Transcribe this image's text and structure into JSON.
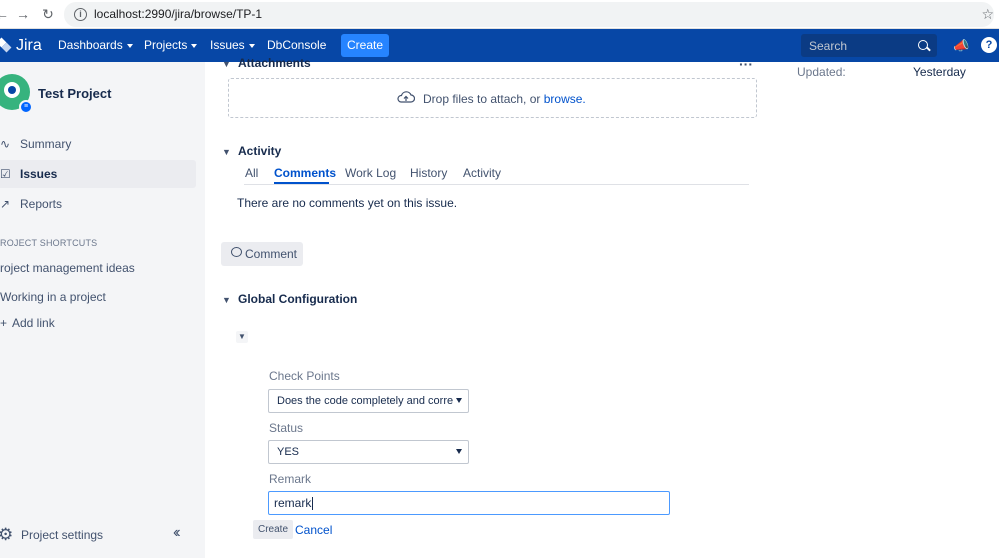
{
  "browser": {
    "url": "localhost:2990/jira/browse/TP-1"
  },
  "header": {
    "logo_text": "Jira",
    "menus": [
      "Dashboards",
      "Projects",
      "Issues",
      "DbConsole"
    ],
    "create_label": "Create",
    "search_placeholder": "Search",
    "help_label": "?"
  },
  "sidebar": {
    "project_name": "Test Project",
    "nav": [
      "Summary",
      "Issues",
      "Reports"
    ],
    "active_item": "Issues",
    "shortcuts_heading": "ROJECT SHORTCUTS",
    "shortcuts": [
      "roject management ideas",
      "Working in a project"
    ],
    "add_link_label": "Add link",
    "settings_label": "Project settings"
  },
  "attachments": {
    "title": "Attachments",
    "drop_text": "Drop files to attach, or ",
    "browse_link": "browse."
  },
  "activity": {
    "title": "Activity",
    "tabs": [
      "All",
      "Comments",
      "Work Log",
      "History",
      "Activity"
    ],
    "active_tab": "Comments",
    "empty_message": "There are no comments yet on this issue.",
    "comment_button": "Comment"
  },
  "global_config": {
    "title": "Global Configuration",
    "fields": {
      "check_points_label": "Check Points",
      "check_points_value": "Does the code completely and correctly implement the design?",
      "status_label": "Status",
      "status_value": "YES",
      "remark_label": "Remark",
      "remark_value": "remark"
    },
    "create_button": "Create",
    "cancel_link": "Cancel"
  },
  "details": {
    "updated_label": "Updated:",
    "updated_value": "Yesterday"
  },
  "colors": {
    "header_bg": "#0747a6",
    "create_bg": "#2684ff",
    "link": "#0052cc",
    "sidebar_bg": "#f4f5f7"
  }
}
